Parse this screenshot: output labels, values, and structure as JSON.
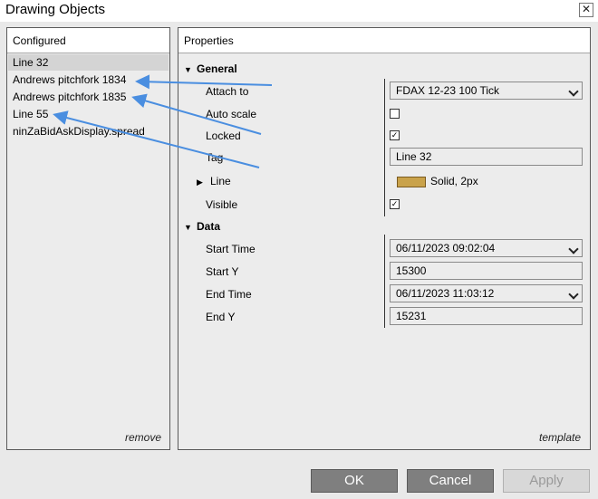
{
  "window": {
    "title": "Drawing Objects",
    "close_glyph": "✕"
  },
  "configured": {
    "header": "Configured",
    "items": [
      "Line 32",
      "Andrews pitchfork 1834",
      "Andrews pitchfork 1835",
      "Line 55",
      "ninZaBidAskDisplay.spread"
    ],
    "selected_index": 0,
    "remove_label": "remove"
  },
  "properties": {
    "header": "Properties",
    "general_label": "General",
    "attach_to_label": "Attach to",
    "attach_to_value": "FDAX 12-23 100 Tick",
    "auto_scale_label": "Auto scale",
    "auto_scale_checked": false,
    "locked_label": "Locked",
    "locked_checked": true,
    "tag_label": "Tag",
    "tag_value": "Line 32",
    "line_label": "Line",
    "line_value": "Solid, 2px",
    "line_color": "#c9a24a",
    "visible_label": "Visible",
    "visible_checked": true,
    "data_label": "Data",
    "start_time_label": "Start Time",
    "start_time_value": "06/11/2023 09:02:04",
    "start_y_label": "Start Y",
    "start_y_value": "15300",
    "end_time_label": "End Time",
    "end_time_value": "06/11/2023 11:03:12",
    "end_y_label": "End Y",
    "end_y_value": "15231",
    "template_label": "template"
  },
  "buttons": {
    "ok": "OK",
    "cancel": "Cancel",
    "apply": "Apply"
  },
  "annotation_color": "#4a8ee0"
}
